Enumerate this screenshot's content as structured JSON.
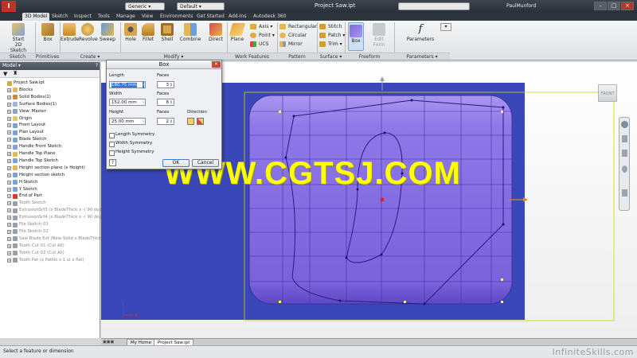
{
  "title_bar": {
    "quick_access": "Generic",
    "default_label": "Default",
    "title": "Project Saw.ipt",
    "user": "PaulMunford"
  },
  "tabs": [
    "3D Model",
    "Sketch",
    "Inspect",
    "Tools",
    "Manage",
    "View",
    "Environments",
    "Get Started",
    "Add-Ins",
    "Autodesk 360"
  ],
  "ribbon": {
    "sketch": {
      "start": "Start",
      "sketch2d": "2D Sketch",
      "group": "Sketch"
    },
    "primitives": {
      "box": "Box",
      "group": "Primitives"
    },
    "create": {
      "extrude": "Extrude",
      "revolve": "Revolve",
      "sweep": "Sweep",
      "group": "Create"
    },
    "modify": {
      "hole": "Hole",
      "fillet": "Fillet",
      "shell": "Shell",
      "combine": "Combine",
      "direct": "Direct",
      "group": "Modify"
    },
    "work": {
      "plane": "Plane",
      "axis": "Axis",
      "point": "Point",
      "ucs": "UCS",
      "group": "Work Features"
    },
    "pattern": {
      "rectangular": "Rectangular",
      "circular": "Circular",
      "mirror": "Mirror",
      "group": "Pattern"
    },
    "surface": {
      "stitch": "Stitch",
      "patch": "Patch",
      "trim": "Trim",
      "group": "Surface"
    },
    "freeform": {
      "box": "Box",
      "edit": "Edit",
      "form": "Form",
      "group": "Freeform"
    },
    "parameters": {
      "label": "Parameters",
      "group": "Parameters"
    }
  },
  "browser": {
    "title": "Model",
    "nodes": [
      {
        "label": "Project Saw.ipt",
        "indent": 0
      },
      {
        "label": "Blocks",
        "indent": 1
      },
      {
        "label": "Solid Bodies(1)",
        "indent": 1
      },
      {
        "label": "Surface Bodies(1)",
        "indent": 1
      },
      {
        "label": "View: Master",
        "indent": 1
      },
      {
        "label": "Origin",
        "indent": 1
      },
      {
        "label": "Front Layout",
        "indent": 1
      },
      {
        "label": "Plan Layout",
        "indent": 1
      },
      {
        "label": "Blade Sketch",
        "indent": 1
      },
      {
        "label": "Handle Front Sketch",
        "indent": 1
      },
      {
        "label": "Handle Top Plane",
        "indent": 1
      },
      {
        "label": "Handle Top Sketch",
        "indent": 1
      },
      {
        "label": "Height section plane (x Height)",
        "indent": 1
      },
      {
        "label": "Height section sketch",
        "indent": 1
      },
      {
        "label": "H Sketch",
        "indent": 1
      },
      {
        "label": "Y Sketch",
        "indent": 1
      },
      {
        "label": "End of Part",
        "indent": 1
      },
      {
        "label": "Tooth Sketch",
        "indent": 1
      },
      {
        "label": "ExtrusionSrf3 (x BladeThick x -( 90 deg -",
        "indent": 1
      },
      {
        "label": "ExtrusionSrf4 (x BladeThick x -( 90 deg",
        "indent": 1
      },
      {
        "label": "File Sketch 01",
        "indent": 1
      },
      {
        "label": "File Sketch 02",
        "indent": 1
      },
      {
        "label": "Saw Blade Ext (New Solid x BladeThick)",
        "indent": 1
      },
      {
        "label": "Tooth Cut 01 (Cut All)",
        "indent": 1
      },
      {
        "label": "Tooth Cut 02 (Cut All)",
        "indent": 1
      },
      {
        "label": "Tooth Pat (x PatNo x 1 ul x Pat)",
        "indent": 1
      }
    ]
  },
  "dialog": {
    "title": "Box",
    "length_label": "Length",
    "length_value": "180.75 mm",
    "width_label": "Width",
    "width_value": "152.00 mm",
    "height_label": "Height",
    "height_value": "25.00 mm",
    "faces_label": "Faces",
    "faces_1": "3",
    "faces_2": "8",
    "faces_3": "2",
    "direction_label": "Direction",
    "length_sym": "Length Symmetry",
    "width_sym": "Width Symmetry",
    "height_sym": "Height Symmetry",
    "ok": "OK",
    "cancel": "Cancel"
  },
  "viewcube": "FRONT",
  "watermark_center": "WWW.CGTSJ.COM",
  "doc_tabs": [
    "My Home",
    "Project Saw.ipt"
  ],
  "status": "Select a feature or dimension",
  "watermark_corner": "InfiniteSkills.com",
  "colors": {
    "surface": "#8b71e6",
    "plane": "#3b47b8",
    "watermark": "#ffff00"
  }
}
